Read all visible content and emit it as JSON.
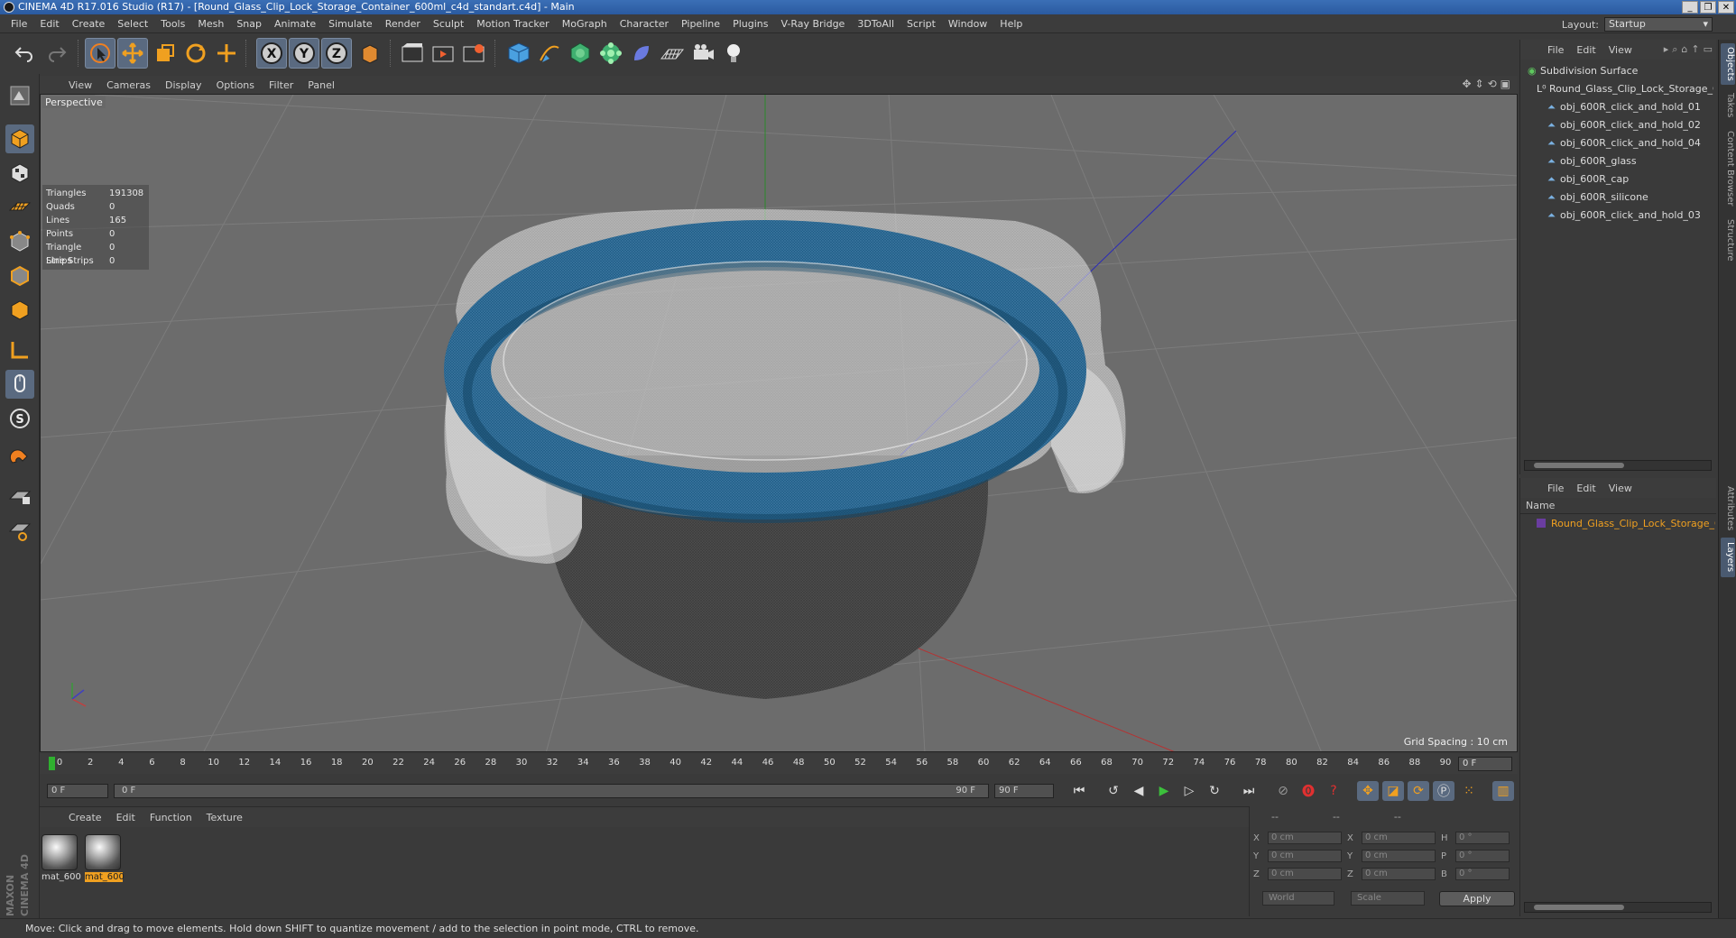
{
  "window": {
    "title": "CINEMA 4D R17.016 Studio (R17) - [Round_Glass_Clip_Lock_Storage_Container_600ml_c4d_standart.c4d] - Main"
  },
  "menubar": {
    "items": [
      "File",
      "Edit",
      "Create",
      "Select",
      "Tools",
      "Mesh",
      "Snap",
      "Animate",
      "Simulate",
      "Render",
      "Sculpt",
      "Motion Tracker",
      "MoGraph",
      "Character",
      "Pipeline",
      "Plugins",
      "V-Ray Bridge",
      "3DToAll",
      "Script",
      "Window",
      "Help"
    ],
    "layout_label": "Layout:",
    "layout_value": "Startup"
  },
  "viewport": {
    "menu": [
      "View",
      "Cameras",
      "Display",
      "Options",
      "Filter",
      "Panel"
    ],
    "camera_label": "Perspective",
    "grid_spacing": "Grid Spacing : 10 cm",
    "stats": [
      {
        "label": "Triangles",
        "value": "191308"
      },
      {
        "label": "Quads",
        "value": "0"
      },
      {
        "label": "Lines",
        "value": "165"
      },
      {
        "label": "Points",
        "value": "0"
      },
      {
        "label": "Triangle Strips",
        "value": "0"
      },
      {
        "label": "Line Strips",
        "value": "0"
      }
    ]
  },
  "timeline": {
    "ticks": [
      "0",
      "2",
      "4",
      "6",
      "8",
      "10",
      "12",
      "14",
      "16",
      "18",
      "20",
      "22",
      "24",
      "26",
      "28",
      "30",
      "32",
      "34",
      "36",
      "38",
      "40",
      "42",
      "44",
      "46",
      "48",
      "50",
      "52",
      "54",
      "56",
      "58",
      "60",
      "62",
      "64",
      "66",
      "68",
      "70",
      "72",
      "74",
      "76",
      "78",
      "80",
      "82",
      "84",
      "86",
      "88",
      "90"
    ],
    "current_frame": "0 F",
    "start_field": "0 F",
    "range_start": "0 F",
    "range_end": "90 F",
    "end_field": "90 F"
  },
  "material_manager": {
    "menu": [
      "Create",
      "Edit",
      "Function",
      "Texture"
    ],
    "materials": [
      {
        "name": "mat_600",
        "selected": false
      },
      {
        "name": "mat_600",
        "selected": true
      }
    ]
  },
  "coordinates": {
    "headers": [
      "--",
      "--",
      "--"
    ],
    "rows": [
      {
        "a": "X",
        "v1": "0 cm",
        "b": "X",
        "v2": "0 cm",
        "c": "H",
        "v3": "0 °"
      },
      {
        "a": "Y",
        "v1": "0 cm",
        "b": "Y",
        "v2": "0 cm",
        "c": "P",
        "v3": "0 °"
      },
      {
        "a": "Z",
        "v1": "0 cm",
        "b": "Z",
        "v2": "0 cm",
        "c": "B",
        "v3": "0 °"
      }
    ],
    "mode": "World",
    "scale_mode": "Scale",
    "apply_label": "Apply"
  },
  "object_manager": {
    "menu": [
      "File",
      "Edit",
      "View"
    ],
    "items": [
      {
        "label": "Subdivision Surface",
        "level": 0,
        "icon": "subdivision-icon"
      },
      {
        "label": "Round_Glass_Clip_Lock_Storage_C",
        "level": 1,
        "icon": "null-icon"
      },
      {
        "label": "obj_600R_click_and_hold_01",
        "level": 2,
        "icon": "polygon-icon"
      },
      {
        "label": "obj_600R_click_and_hold_02",
        "level": 2,
        "icon": "polygon-icon"
      },
      {
        "label": "obj_600R_click_and_hold_04",
        "level": 2,
        "icon": "polygon-icon"
      },
      {
        "label": "obj_600R_glass",
        "level": 2,
        "icon": "polygon-icon"
      },
      {
        "label": "obj_600R_cap",
        "level": 2,
        "icon": "polygon-icon"
      },
      {
        "label": "obj_600R_silicone",
        "level": 2,
        "icon": "polygon-icon"
      },
      {
        "label": "obj_600R_click_and_hold_03",
        "level": 2,
        "icon": "polygon-icon"
      }
    ]
  },
  "layer_manager": {
    "menu": [
      "File",
      "Edit",
      "View"
    ],
    "column_name": "Name",
    "layer": "Round_Glass_Clip_Lock_Storage_Co",
    "layer_color": "#6a3da0"
  },
  "side_tabs": [
    "Objects",
    "Takes",
    "Content Browser",
    "Structure",
    "Attributes",
    "Layers"
  ],
  "status": {
    "text": "Move: Click and drag to move elements. Hold down SHIFT to quantize movement / add to the selection in point mode, CTRL to remove."
  },
  "colors": {
    "accent": "#f0a020",
    "active_button": "#5a6a80",
    "silicone_ring": "#1f5b85",
    "viewport_bg": "#6c6c6c"
  }
}
